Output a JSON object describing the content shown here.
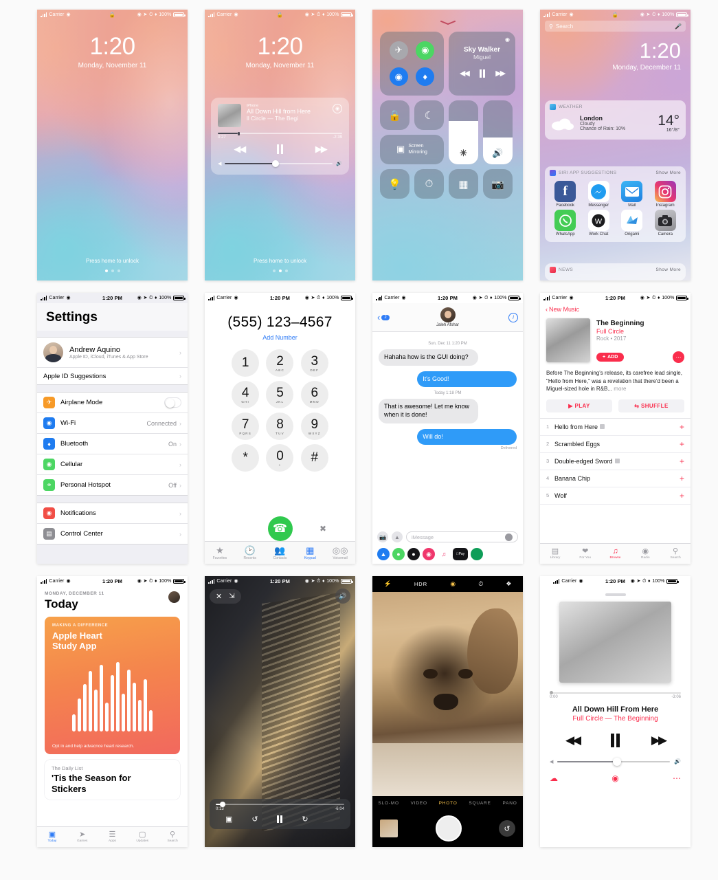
{
  "status_bar": {
    "carrier": "Carrier",
    "time": "1:20 PM",
    "battery": "100%"
  },
  "screens": {
    "lock1": {
      "name": "Lock Screen",
      "time": "1:20",
      "date": "Monday, November 11",
      "footer": "Press home to unlock"
    },
    "lock2": {
      "name": "Lock Screen with Music",
      "time": "1:20",
      "date": "Monday, November 11",
      "footer": "Press home to unlock",
      "music": {
        "source": "iPhone",
        "title": "All Down Hill from Here",
        "subtitle": "ll Circle — The Begi",
        "elapsed": "0:27",
        "remaining": "-2:39",
        "airplay_icon": "airplay-icon",
        "prev_icon": "rewind-icon",
        "pause_icon": "pause-icon",
        "next_icon": "fast-forward-icon"
      }
    },
    "control_center": {
      "name": "Control Center",
      "toggles": [
        {
          "label": "Airplane Mode",
          "icon": "airplane-icon",
          "color": "#a8a8ad",
          "active": false
        },
        {
          "label": "Cellular Data",
          "icon": "cellular-icon",
          "color": "#4cd663",
          "active": true
        },
        {
          "label": "Wi-Fi",
          "icon": "wifi-icon",
          "color": "#1f7cf0",
          "active": true
        },
        {
          "label": "Bluetooth",
          "icon": "bluetooth-icon",
          "color": "#1f7cf0",
          "active": true
        }
      ],
      "music": {
        "title": "Sky Walker",
        "artist": "Miguel",
        "prev_icon": "rewind-icon",
        "pause_icon": "pause-icon",
        "next_icon": "fast-forward-icon"
      },
      "squares": [
        {
          "label": "Rotation Lock",
          "icon": "rotation-lock-icon"
        },
        {
          "label": "Do Not Disturb",
          "icon": "moon-icon"
        }
      ],
      "screen_mirroring": {
        "label_line1": "Screen",
        "label_line2": "Mirroring",
        "icon": "screen-mirroring-icon"
      },
      "brightness": {
        "label": "Brightness",
        "icon": "brightness-icon",
        "value": 68
      },
      "volume": {
        "label": "Volume",
        "icon": "volume-icon",
        "value": 42
      },
      "bottom": [
        {
          "label": "Flashlight",
          "icon": "flashlight-icon"
        },
        {
          "label": "Timer",
          "icon": "timer-icon"
        },
        {
          "label": "Calculator",
          "icon": "calculator-icon"
        },
        {
          "label": "Camera",
          "icon": "camera-icon"
        }
      ]
    },
    "today_view": {
      "name": "Today View",
      "search_placeholder": "Search",
      "time": "1:20",
      "date": "Monday, December 11",
      "weather": {
        "header": "WEATHER",
        "city": "London",
        "condition": "Cloudy",
        "rain": "Chance of Rain: 10%",
        "temp": "14°",
        "hi_lo": "16°/8°"
      },
      "siri": {
        "header": "SIRI APP SUGGESTIONS",
        "show_more": "Show More",
        "apps": [
          {
            "label": "Facebook",
            "icon": "facebook-icon"
          },
          {
            "label": "Messenger",
            "icon": "messenger-icon"
          },
          {
            "label": "Mail",
            "icon": "mail-icon"
          },
          {
            "label": "Instagram",
            "icon": "instagram-icon"
          },
          {
            "label": "WhatsApp",
            "icon": "whatsapp-icon"
          },
          {
            "label": "Work Chat",
            "icon": "work-chat-icon"
          },
          {
            "label": "Origami",
            "icon": "origami-icon"
          },
          {
            "label": "Camera",
            "icon": "camera-icon"
          }
        ]
      },
      "news": {
        "header": "NEWS",
        "show_more": "Show More"
      }
    },
    "settings": {
      "name": "Settings",
      "title": "Settings",
      "account": {
        "name": "Andrew Aquino",
        "subtitle": "Apple ID, iCloud, iTunes & App Store"
      },
      "suggestions_label": "Apple ID Suggestions",
      "group1": [
        {
          "label": "Airplane Mode",
          "icon": "airplane-icon",
          "color": "#f79a27",
          "control": "toggle",
          "value": ""
        },
        {
          "label": "Wi-Fi",
          "icon": "wifi-icon",
          "color": "#1f7cf0",
          "control": "chevron",
          "value": "Connected"
        },
        {
          "label": "Bluetooth",
          "icon": "bluetooth-icon",
          "color": "#1f7cf0",
          "control": "chevron",
          "value": "On"
        },
        {
          "label": "Cellular",
          "icon": "cellular-icon",
          "color": "#4cd663",
          "control": "chevron",
          "value": ""
        },
        {
          "label": "Personal Hotspot",
          "icon": "hotspot-icon",
          "color": "#4cd663",
          "control": "chevron",
          "value": "Off"
        }
      ],
      "group2": [
        {
          "label": "Notifications",
          "icon": "notifications-icon",
          "color": "#f14e46",
          "control": "chevron",
          "value": ""
        },
        {
          "label": "Control Center",
          "icon": "control-center-icon",
          "color": "#8e8e93",
          "control": "chevron",
          "value": ""
        }
      ]
    },
    "phone": {
      "name": "Phone Keypad",
      "number": "(555) 123–4567",
      "add_number": "Add Number",
      "keys": [
        {
          "digit": "1",
          "letters": ""
        },
        {
          "digit": "2",
          "letters": "ABC"
        },
        {
          "digit": "3",
          "letters": "DEF"
        },
        {
          "digit": "4",
          "letters": "GHI"
        },
        {
          "digit": "5",
          "letters": "JKL"
        },
        {
          "digit": "6",
          "letters": "MNO"
        },
        {
          "digit": "7",
          "letters": "PQRS"
        },
        {
          "digit": "8",
          "letters": "TUV"
        },
        {
          "digit": "9",
          "letters": "WXYZ"
        },
        {
          "digit": "*",
          "letters": ""
        },
        {
          "digit": "0",
          "letters": "+"
        },
        {
          "digit": "#",
          "letters": ""
        }
      ],
      "call_icon": "phone-icon",
      "delete_icon": "delete-icon",
      "tabs": [
        {
          "label": "Favorites",
          "icon": "star-icon",
          "active": false
        },
        {
          "label": "Recents",
          "icon": "clock-icon",
          "active": false
        },
        {
          "label": "Contacts",
          "icon": "contacts-icon",
          "active": false
        },
        {
          "label": "Keypad",
          "icon": "keypad-icon",
          "active": true
        },
        {
          "label": "Voicemail",
          "icon": "voicemail-icon",
          "active": false
        }
      ]
    },
    "messages": {
      "name": "Messages",
      "back_badge": "2",
      "contact": "Jaleh Afshar",
      "info_icon": "info-icon",
      "thread": [
        {
          "kind": "timestamp",
          "text": "Sun, Dec 11 1:20 PM"
        },
        {
          "kind": "in",
          "text": "Hahaha how is the GUI doing?"
        },
        {
          "kind": "out",
          "text": "It's Good!"
        },
        {
          "kind": "timestamp",
          "text": "Today 1:18 PM"
        },
        {
          "kind": "in",
          "text": "That is awesome! Let me know when it is done!"
        },
        {
          "kind": "out",
          "text": "Will do!"
        }
      ],
      "delivered": "Delivered",
      "input_placeholder": "iMessage",
      "camera_icon": "camera-icon",
      "appstore_icon": "app-store-icon",
      "mic_icon": "mic-icon",
      "app_drawer": [
        {
          "name": "app-store-icon",
          "color": "#1f7cf0"
        },
        {
          "name": "fruit-icon",
          "color": "#4cd663"
        },
        {
          "name": "music-dark-icon",
          "color": "#111111"
        },
        {
          "name": "images-icon",
          "color": "#f0376c"
        },
        {
          "name": "music-note-icon",
          "color": "#ffffff"
        },
        {
          "name": "apple-pay-icon",
          "color": "#111111"
        },
        {
          "name": "green-app-icon",
          "color": "#0f9d58"
        }
      ]
    },
    "music_album": {
      "name": "Apple Music Album",
      "back": "New Music",
      "album": "The Beginning",
      "artist": "Full Circle",
      "genre_year": "Rock • 2017",
      "add_label": "ADD",
      "more_icon": "more-icon",
      "description": "Before The Beginning's release, its carefree lead single, \"Hello from Here,\" was a revelation that there'd been a Miguel-sized hole in R&B...",
      "description_more": "more",
      "play_label": "PLAY",
      "shuffle_label": "SHUFFLE",
      "tracks": [
        {
          "n": "1",
          "title": "Hello from Here",
          "explicit": true
        },
        {
          "n": "2",
          "title": "Scrambled Eggs",
          "explicit": false
        },
        {
          "n": "3",
          "title": "Double-edged Sword",
          "explicit": true
        },
        {
          "n": "4",
          "title": "Banana Chip",
          "explicit": false
        },
        {
          "n": "5",
          "title": "Wolf",
          "explicit": false
        }
      ],
      "tabs": [
        {
          "label": "Library",
          "icon": "library-icon",
          "active": false
        },
        {
          "label": "For You",
          "icon": "heart-icon",
          "active": false
        },
        {
          "label": "Browse",
          "icon": "music-note-icon",
          "active": true
        },
        {
          "label": "Radio",
          "icon": "radio-icon",
          "active": false
        },
        {
          "label": "Search",
          "icon": "search-icon",
          "active": false
        }
      ]
    },
    "app_store": {
      "name": "App Store Today",
      "date": "MONDAY, DECEMBER 11",
      "title": "Today",
      "feature": {
        "kicker": "MAKING A DIFFERENCE",
        "title_line1": "Apple Heart",
        "title_line2": "Study App",
        "footer": "Opt in and help advacnce heart research."
      },
      "second_card": {
        "kicker": "The Daily List",
        "title_line1": "'Tis the Season for",
        "title_line2": "Stickers"
      },
      "tabs": [
        {
          "label": "Today",
          "icon": "today-icon",
          "active": true
        },
        {
          "label": "Games",
          "icon": "games-icon",
          "active": false
        },
        {
          "label": "Apps",
          "icon": "apps-icon",
          "active": false
        },
        {
          "label": "Updates",
          "icon": "updates-icon",
          "active": false
        },
        {
          "label": "Search",
          "icon": "search-icon",
          "active": false
        }
      ]
    },
    "video": {
      "name": "Video Player",
      "close_icon": "close-icon",
      "shrink_icon": "shrink-icon",
      "volume_icon": "volume-icon",
      "elapsed": "0:13",
      "remaining": "-6:04",
      "airplay_icon": "airplay-icon",
      "back15_icon": "back-15-icon",
      "pause_icon": "pause-icon",
      "forward15_icon": "forward-15-icon"
    },
    "camera": {
      "name": "Camera",
      "flash_icon": "flash-icon",
      "hdr_label": "HDR",
      "live_icon": "live-photo-icon",
      "timer_icon": "timer-icon",
      "filter_icon": "filters-icon",
      "modes": [
        "SLO-MO",
        "VIDEO",
        "PHOTO",
        "SQUARE",
        "PANO"
      ],
      "active_mode": "PHOTO",
      "shutter_icon": "shutter-button",
      "flip_icon": "flip-camera-icon",
      "thumb_icon": "last-photo-thumbnail"
    },
    "now_playing": {
      "name": "Now Playing",
      "elapsed": "0:00",
      "remaining": "-3:06",
      "title": "All Down Hill From Here",
      "subtitle": "Full Circle — The Beginning",
      "prev_icon": "rewind-icon",
      "pause_icon": "pause-icon",
      "next_icon": "fast-forward-icon",
      "download_icon": "download-icon",
      "airplay_icon": "airplay-icon",
      "more_icon": "more-icon"
    }
  }
}
